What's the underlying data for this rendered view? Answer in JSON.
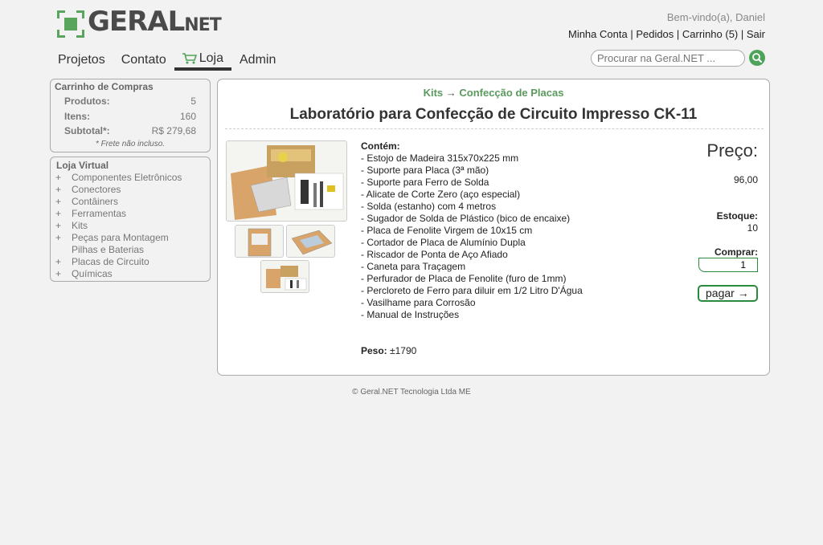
{
  "brand": {
    "name_main": "GERAL",
    "name_suffix": "NET"
  },
  "header": {
    "welcome": "Bem-vindo(a), Daniel",
    "links": [
      "Minha Conta",
      "Pedidos",
      "Carrinho (5)",
      "Sair"
    ],
    "separator": " | "
  },
  "nav": {
    "items": [
      "Projetos",
      "Contato",
      "Loja",
      "Admin"
    ],
    "active": "Loja"
  },
  "search": {
    "placeholder": "Procurar na Geral.NET ..."
  },
  "cart": {
    "title": "Carrinho de Compras",
    "rows": [
      {
        "label": "Produtos:",
        "value": "5"
      },
      {
        "label": "Itens:",
        "value": "160"
      },
      {
        "label": "Subtotal*:",
        "value": "R$ 279,68"
      }
    ],
    "note": "* Frete não incluso."
  },
  "store": {
    "title": "Loja Virtual",
    "categories": [
      {
        "plus": "+",
        "label": "Componentes Eletrônicos"
      },
      {
        "plus": "+",
        "label": "Conectores"
      },
      {
        "plus": "+",
        "label": "Contâiners"
      },
      {
        "plus": "+",
        "label": "Ferramentas"
      },
      {
        "plus": "+",
        "label": "Kits"
      },
      {
        "plus": "+",
        "label": "Peças para Montagem"
      },
      {
        "plus": "",
        "label": "Pilhas e Baterias"
      },
      {
        "plus": "+",
        "label": "Placas de Circuito"
      },
      {
        "plus": "+",
        "label": "Químicas"
      }
    ]
  },
  "product": {
    "breadcrumb": [
      "Kits",
      "Confecção de Placas"
    ],
    "breadcrumb_arrow": "→",
    "title": "Laboratório para Confecção de Circuito Impresso CK-11",
    "contents_heading": "Contém:",
    "contents": [
      "- Estojo de Madeira 315x70x225 mm",
      "- Suporte para Placa (3ª mão)",
      "- Suporte para Ferro de Solda",
      "- Alicate de Corte Zero (aço especial)",
      "- Solda (estanho) com 4 metros",
      "- Sugador de Solda de Plástico (bico de encaixe)",
      "- Placa de Fenolite Virgem de 10x15 cm",
      "- Cortador de Placa de Alumínio Dupla",
      "- Riscador de Ponta de Aço Afiado",
      "- Caneta para Traçagem",
      "- Perfurador de Placa de Fenolite (furo de 1mm)",
      "- Percloreto de Ferro para diluir em 1/2 Litro D'Água",
      "- Vasilhame para Corrosão",
      "- Manual de Instruções"
    ],
    "weight_label": "Peso:",
    "weight_value": "±1790",
    "price_label": "Preço:",
    "price": "96,00",
    "stock_label": "Estoque:",
    "stock": "10",
    "buy_label": "Comprar:",
    "quantity": "1",
    "pay_button": "pagar →"
  },
  "footer": "© Geral.NET Tecnologia Ltda ME",
  "colors": {
    "accent": "#5aa55e",
    "button_border": "#2a8a3e"
  }
}
